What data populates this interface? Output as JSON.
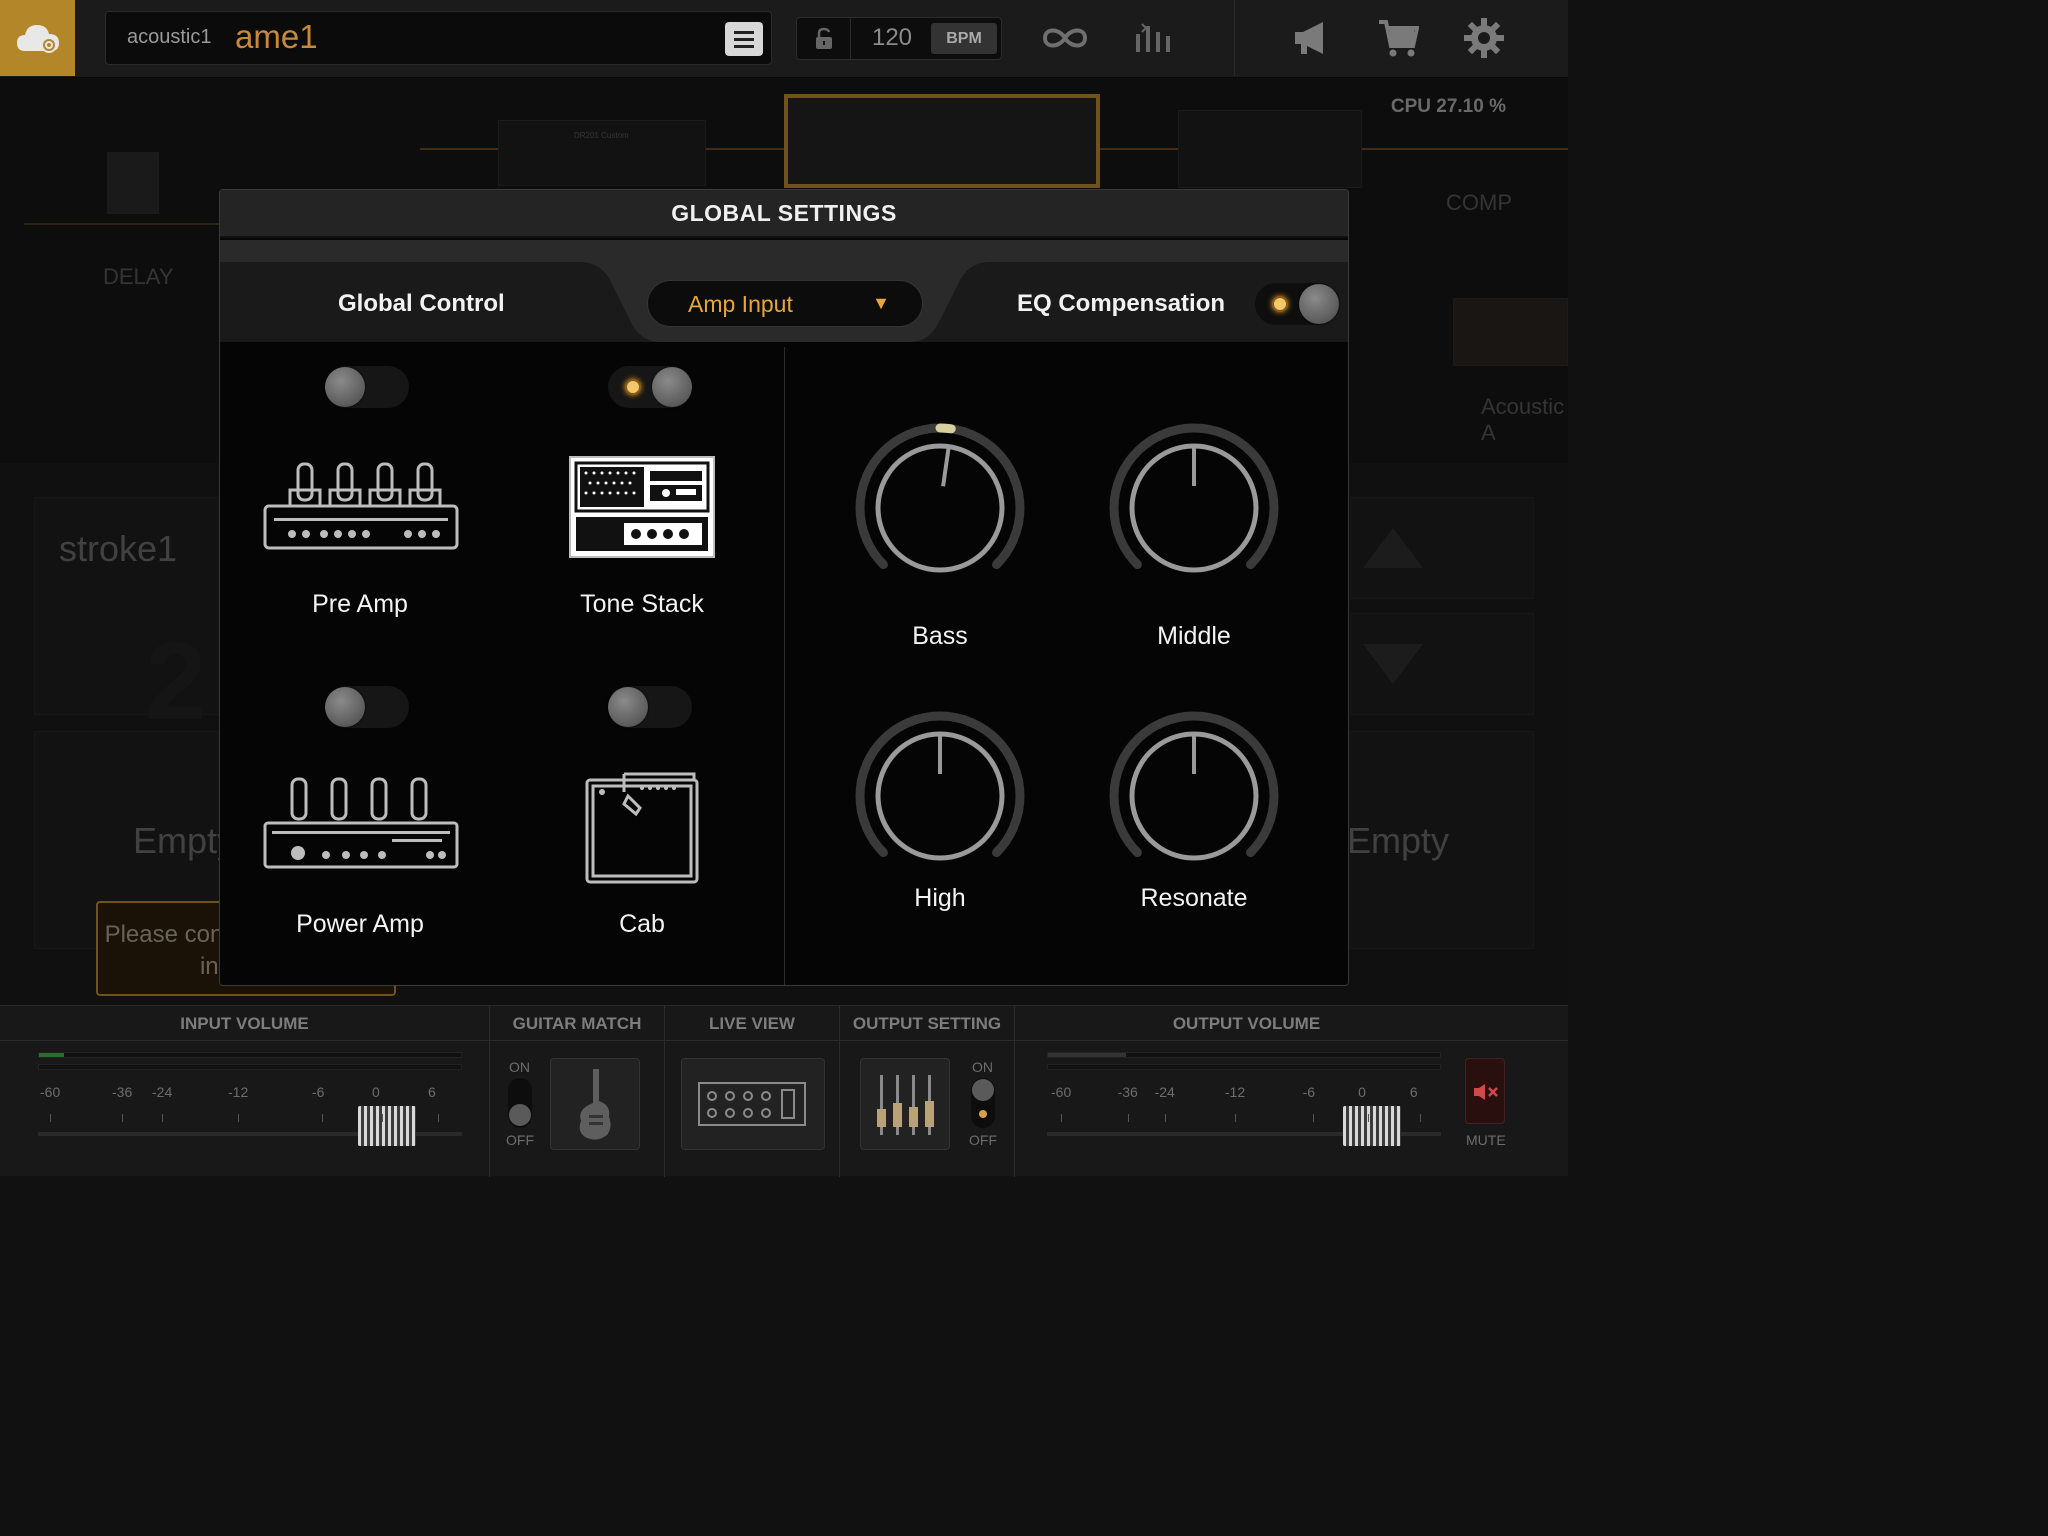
{
  "topbar": {
    "logo_icon": "cloud-icon",
    "preset_bank": "acoustic1",
    "preset_name": "ame1",
    "menu_icon": "hamburger-icon",
    "lock_icon": "lock-icon",
    "bpm_value": "120",
    "bpm_label": "BPM",
    "loop_icon": "infinity-icon",
    "mixer_icon": "mixer-icon",
    "announce_icon": "megaphone-icon",
    "cart_icon": "cart-icon",
    "settings_icon": "gear-icon"
  },
  "chain": {
    "cpu": "CPU 27.10 %",
    "delay_label": "DELAY",
    "comp_label": "COMP",
    "acoustic_label": "Acoustic A",
    "amp_plate": "DR201 Custom"
  },
  "lower": {
    "scene_name": "stroke1",
    "scene_number": "2",
    "slot_empty_label": "Empty",
    "tooltip": "Please connect your audio interface"
  },
  "bottom": {
    "input_volume": "INPUT VOLUME",
    "guitar_match": "GUITAR MATCH",
    "live_view": "LIVE VIEW",
    "output_setting": "OUTPUT SETTING",
    "output_volume": "OUTPUT VOLUME",
    "on": "ON",
    "off": "OFF",
    "mute": "MUTE",
    "scale": [
      "-60",
      "-36",
      "-24",
      "-12",
      "-6",
      "0",
      "6"
    ],
    "input_level": 0.06,
    "output_level": 0.2
  },
  "modal": {
    "title": "GLOBAL SETTINGS",
    "global_control": "Global Control",
    "dropdown_value": "Amp Input",
    "eq_compensation": "EQ Compensation",
    "eq_compensation_on": true,
    "modules": [
      {
        "label": "Pre Amp",
        "on": false,
        "icon": "preamp-icon"
      },
      {
        "label": "Tone Stack",
        "on": true,
        "icon": "tone-stack-icon"
      },
      {
        "label": "Power Amp",
        "on": false,
        "icon": "power-amp-icon"
      },
      {
        "label": "Cab",
        "on": false,
        "icon": "cab-icon"
      }
    ],
    "knobs": [
      {
        "label": "Bass",
        "value": 0.53
      },
      {
        "label": "Middle",
        "value": 0.5
      },
      {
        "label": "High",
        "value": 0.5
      },
      {
        "label": "Resonate",
        "value": 0.5
      }
    ],
    "colors": {
      "accent": "#e7a53c",
      "led": "#f3c76b",
      "knob_highlight": "#d8cfa0"
    }
  }
}
